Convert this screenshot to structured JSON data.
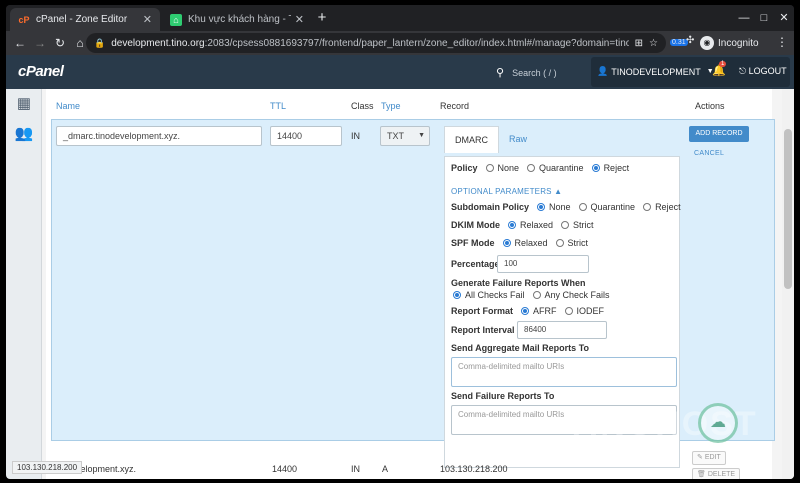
{
  "browser": {
    "tabs": [
      {
        "title": "cPanel - Zone Editor",
        "favicon": "cpanel-icon"
      },
      {
        "title": "Khu vực khách hàng - Tino",
        "favicon": "tino-icon"
      }
    ],
    "url_host": "development.tino.org",
    "url_rest": ":2083/cpsess0881693797/frontend/paper_lantern/zone_editor/index.html#/manage?domain=tinodevelo...",
    "extension_badge": "0.31",
    "incognito_label": "Incognito"
  },
  "cpanel": {
    "logo": "cPanel",
    "search_placeholder": "Search ( / )",
    "username": "TINODEVELOPMENT",
    "notification_count": "1",
    "logout": "LOGOUT"
  },
  "table": {
    "headers": {
      "name": "Name",
      "ttl": "TTL",
      "class": "Class",
      "type": "Type",
      "record": "Record",
      "actions": "Actions"
    }
  },
  "edit": {
    "name_value": "_dmarc.tinodevelopment.xyz.",
    "ttl_value": "14400",
    "class_value": "IN",
    "type_value": "TXT",
    "add_record": "ADD RECORD",
    "cancel": "CANCEL",
    "tabs": [
      "DMARC",
      "Raw"
    ],
    "policy": {
      "label": "Policy",
      "options": [
        "None",
        "Quarantine",
        "Reject"
      ],
      "selected": "Reject"
    },
    "optional_params": "OPTIONAL PARAMETERS",
    "subdomain_policy": {
      "label": "Subdomain Policy",
      "options": [
        "None",
        "Quarantine",
        "Reject"
      ],
      "selected": "None"
    },
    "dkim_mode": {
      "label": "DKIM Mode",
      "options": [
        "Relaxed",
        "Strict"
      ],
      "selected": "Relaxed"
    },
    "spf_mode": {
      "label": "SPF Mode",
      "options": [
        "Relaxed",
        "Strict"
      ],
      "selected": "Relaxed"
    },
    "percentage": {
      "label": "Percentage",
      "value": "100"
    },
    "failure_reports": {
      "label": "Generate Failure Reports When",
      "options": [
        "All Checks Fail",
        "Any Check Fails"
      ],
      "selected": "All Checks Fail"
    },
    "report_format": {
      "label": "Report Format",
      "options": [
        "AFRF",
        "IODEF"
      ],
      "selected": "AFRF"
    },
    "report_interval": {
      "label": "Report Interval",
      "value": "86400"
    },
    "aggregate": {
      "label": "Send Aggregate Mail Reports To",
      "placeholder": "Comma-delimited mailto URIs"
    },
    "failure_to": {
      "label": "Send Failure Reports To",
      "placeholder": "Comma-delimited mailto URIs"
    }
  },
  "row2": {
    "name": "development.xyz.",
    "ttl": "14400",
    "class": "IN",
    "type": "A",
    "record": "103.130.218.200",
    "edit": "EDIT",
    "delete": "DELETE"
  },
  "status_bar_url": "103.130.218.200",
  "watermark": "TINOHOST"
}
